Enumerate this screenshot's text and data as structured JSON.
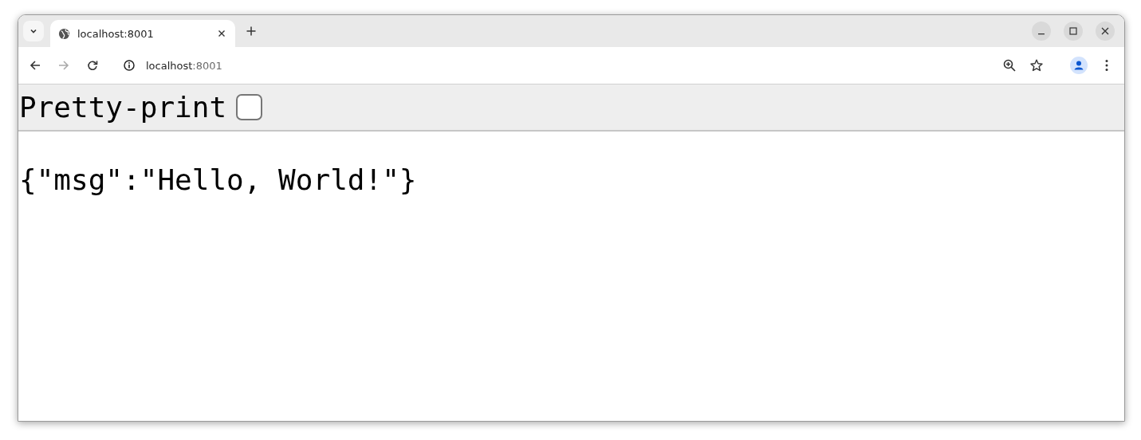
{
  "browser": {
    "tab": {
      "title": "localhost:8001",
      "selected": true
    },
    "address": {
      "host": "localhost",
      "port": ":8001"
    }
  },
  "page": {
    "toolbar": {
      "label": "Pretty-print",
      "checked": false
    },
    "body": "{\"msg\":\"Hello, World!\"}"
  }
}
